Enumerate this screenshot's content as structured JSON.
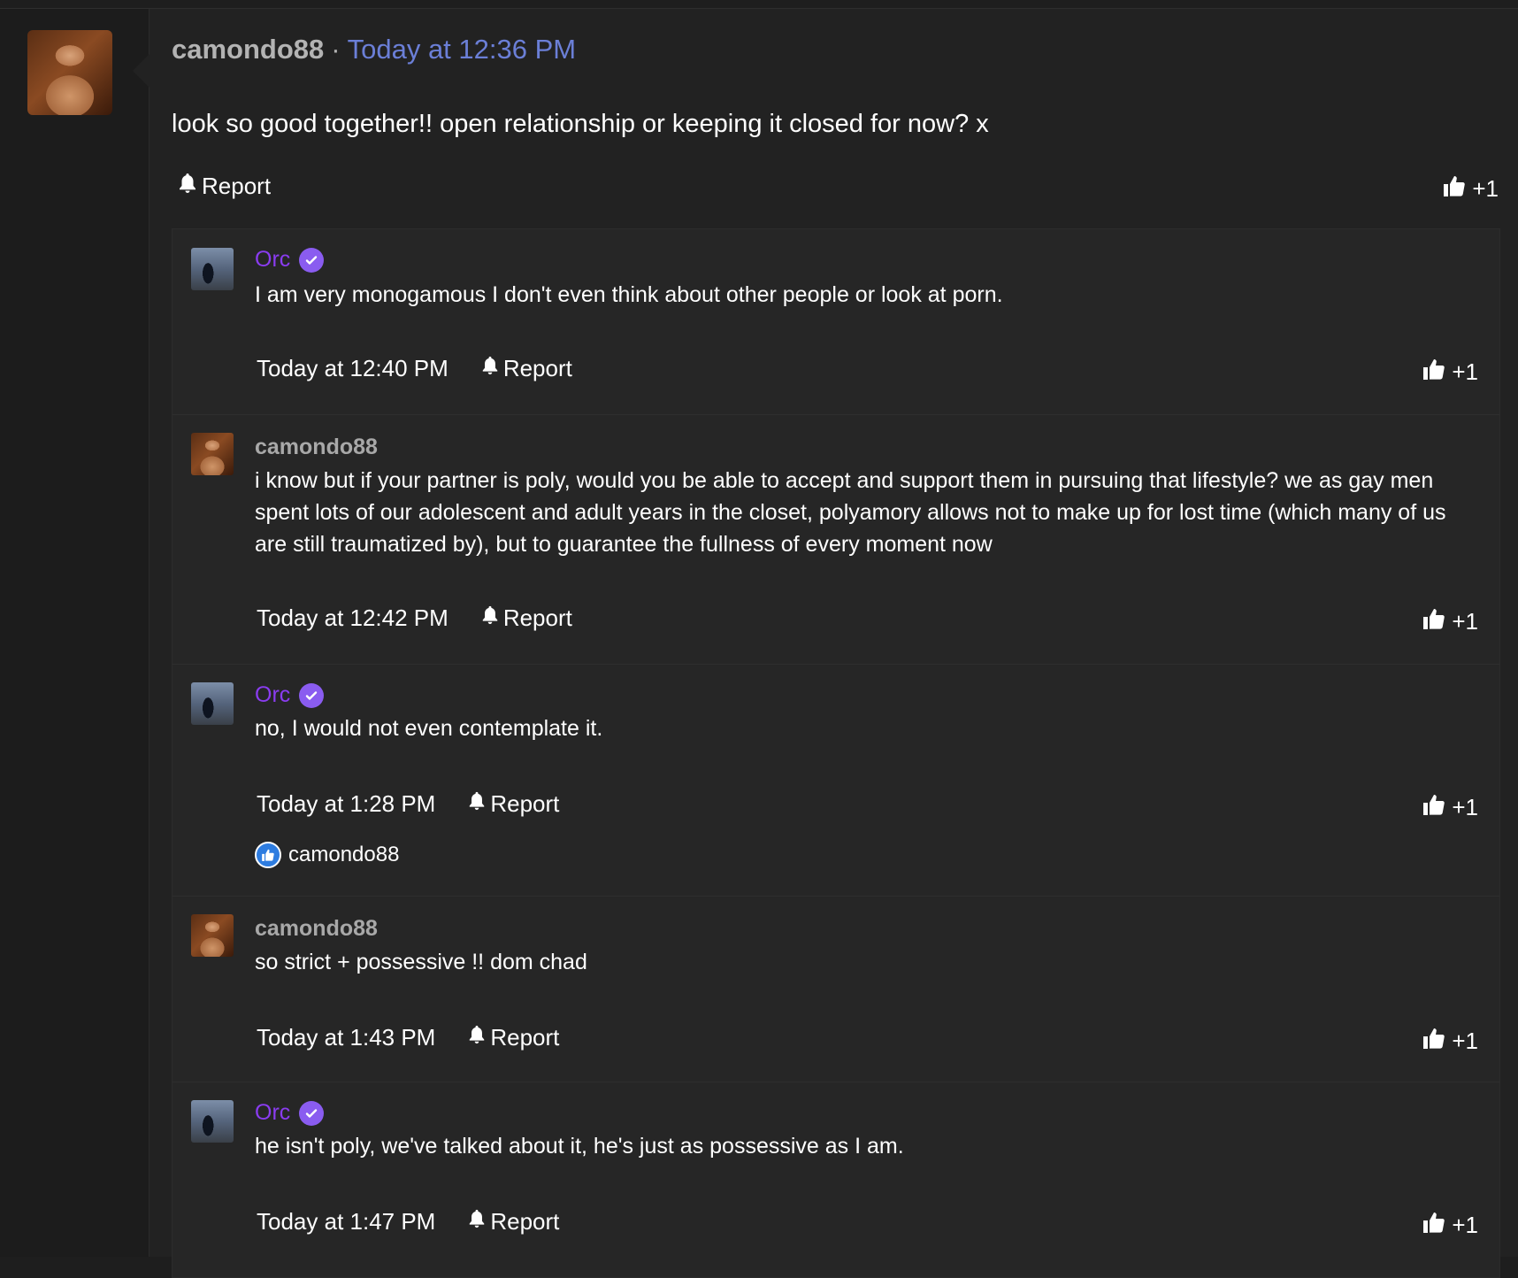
{
  "post": {
    "author": "camondo88",
    "separator": "·",
    "time": "Today at 12:36 PM",
    "body": "look so good together!! open relationship or keeping it closed for now? x",
    "report_label": "Report",
    "like_label": "+1"
  },
  "replies": [
    {
      "author": "Orc",
      "verified": true,
      "text": "I am very monogamous I don't even think about other people or look at porn.",
      "time": "Today at 12:40 PM",
      "report_label": "Report",
      "like_label": "+1"
    },
    {
      "author": "camondo88",
      "verified": false,
      "text": "i know but if your partner is poly, would you be able to accept and support them in pursuing that lifestyle? we as gay men spent lots of our adolescent and adult years in the closet, polyamory allows not to make up for lost time (which many of us are still traumatized by), but to guarantee the fullness of every moment now",
      "time": "Today at 12:42 PM",
      "report_label": "Report",
      "like_label": "+1"
    },
    {
      "author": "Orc",
      "verified": true,
      "text": "no, I would not even contemplate it.",
      "time": "Today at 1:28 PM",
      "report_label": "Report",
      "like_label": "+1",
      "reactor": "camondo88"
    },
    {
      "author": "camondo88",
      "verified": false,
      "text": "so strict + possessive !! dom chad",
      "time": "Today at 1:43 PM",
      "report_label": "Report",
      "like_label": "+1"
    },
    {
      "author": "Orc",
      "verified": true,
      "text": "he isn't poly, we've talked about it, he's just as possessive as I am.",
      "time": "Today at 1:47 PM",
      "report_label": "Report",
      "like_label": "+1"
    }
  ],
  "colors": {
    "background": "#1e1e1e",
    "panel": "#222222",
    "reply_bg": "#262626",
    "time_link": "#6b7fd7",
    "orc_name": "#8a3cf0",
    "verified_badge": "#8a5cf0",
    "reactor_icon": "#2d7ce0"
  },
  "icons": {
    "report": "bell-icon",
    "like": "thumbs-up-icon",
    "verified": "check-badge-icon"
  }
}
